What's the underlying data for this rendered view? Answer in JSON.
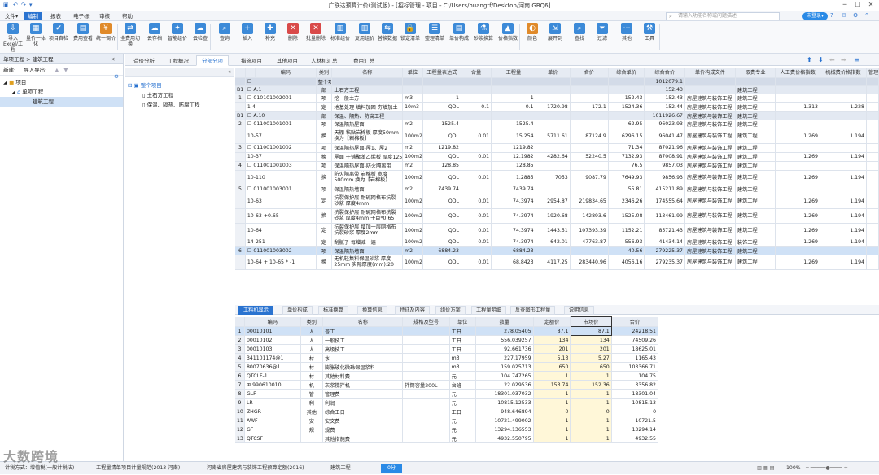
{
  "window": {
    "title": "广联达预算计价(测试版) - [招标管理 - 项目 - C:/Users/huangtf/Desktop/河南.GBQ6]",
    "quick_access": [
      "▣",
      "↶",
      "↷",
      "▾"
    ],
    "min": "─",
    "max": "☐",
    "close": "✕"
  },
  "menu": {
    "items": [
      "文件▾",
      "编制",
      "报表",
      "电子标",
      "审核",
      "帮助"
    ],
    "active": 1,
    "search_placeholder": "请输入功能名称或问题描述",
    "user_pill": "未登录▾"
  },
  "ribbon": {
    "buttons": [
      {
        "label": "导入Excel/工程",
        "color": "#3c8ad8",
        "glyph": "⇩"
      },
      {
        "label": "量价一体化",
        "color": "#3c8ad8",
        "glyph": "▦"
      },
      {
        "label": "项目自检",
        "color": "#3c8ad8",
        "glyph": "✔"
      },
      {
        "label": "费用查看",
        "color": "#3c8ad8",
        "glyph": "▤"
      },
      {
        "label": "统一调价",
        "color": "#e08a2a",
        "glyph": "¥"
      },
      {
        "label": "全费用切换",
        "color": "#3c8ad8",
        "glyph": "⇄"
      },
      {
        "label": "云存档",
        "color": "#3c8ad8",
        "glyph": "☁"
      },
      {
        "label": "智能组价",
        "color": "#3c8ad8",
        "glyph": "✦"
      },
      {
        "label": "云检查",
        "color": "#3c8ad8",
        "glyph": "☁"
      },
      {
        "label": "查询",
        "color": "#3c8ad8",
        "glyph": "⌕"
      },
      {
        "label": "插入",
        "color": "#3c8ad8",
        "glyph": "+"
      },
      {
        "label": "补充",
        "color": "#3c8ad8",
        "glyph": "✚"
      },
      {
        "label": "删除",
        "color": "#d94a4a",
        "glyph": "✕"
      },
      {
        "label": "批量删除",
        "color": "#d94a4a",
        "glyph": "✕"
      },
      {
        "label": "标准组价",
        "color": "#3c8ad8",
        "glyph": "▥"
      },
      {
        "label": "复用组价",
        "color": "#3c8ad8",
        "glyph": "▥"
      },
      {
        "label": "替换数据",
        "color": "#3c8ad8",
        "glyph": "⇆"
      },
      {
        "label": "锁定清单",
        "color": "#3c8ad8",
        "glyph": "🔒"
      },
      {
        "label": "整理清单",
        "color": "#3c8ad8",
        "glyph": "☰"
      },
      {
        "label": "单价构成",
        "color": "#3c8ad8",
        "glyph": "▤"
      },
      {
        "label": "砂浆换算",
        "color": "#3c8ad8",
        "glyph": "⚗"
      },
      {
        "label": "价格指数",
        "color": "#3c8ad8",
        "glyph": "▲"
      },
      {
        "label": "颜色",
        "color": "#e08a2a",
        "glyph": "◐"
      },
      {
        "label": "展开到",
        "color": "#3c8ad8",
        "glyph": "⇲"
      },
      {
        "label": "查找",
        "color": "#3c8ad8",
        "glyph": "⌕"
      },
      {
        "label": "过滤",
        "color": "#3c8ad8",
        "glyph": "⏷"
      },
      {
        "label": "其他",
        "color": "#3c8ad8",
        "glyph": "⋯"
      },
      {
        "label": "工具",
        "color": "#3c8ad8",
        "glyph": "⚒"
      }
    ]
  },
  "left": {
    "breadcrumb": "单项工程 > 建筑工程",
    "new_label": "新建·",
    "import_label": "导入导出·",
    "tree": [
      "项目",
      "单项工程",
      "建筑工程"
    ]
  },
  "tabs": {
    "items": [
      "造价分析",
      "工程概况",
      "分部分项",
      "措施项目",
      "其他项目",
      "人材机汇总",
      "费用汇总"
    ],
    "active": 2
  },
  "navtree": {
    "items": [
      "整个项目",
      "土石方工程",
      "保温、隔热、防腐工程"
    ]
  },
  "grid": {
    "headers": [
      "",
      "",
      "编码",
      "类别",
      "名称",
      "单位",
      "工程量表达式",
      "含量",
      "工程量",
      "单价",
      "合价",
      "综合单价",
      "综合合价",
      "单价构成文件",
      "取费专业",
      "人工费价格指数",
      "机械费价格指数",
      "管理"
    ],
    "rows": [
      {
        "cls": "g1",
        "cells": [
          "",
          "☐",
          "",
          "整个项目",
          "",
          "",
          "",
          "",
          "",
          "",
          "",
          "",
          "1012079.1",
          "",
          "",
          "",
          "",
          ""
        ]
      },
      {
        "cls": "g2",
        "cells": [
          "B1",
          "☐ A.1",
          "",
          "部",
          "土石方工程",
          "",
          "",
          "",
          "",
          "",
          "",
          "",
          "152.43",
          "",
          "建筑工程",
          "",
          "",
          ""
        ]
      },
      {
        "cls": "nor",
        "cells": [
          "1",
          "☐ 010101002001",
          "",
          "项",
          "挖一般土方",
          "m3",
          "1",
          "",
          "1",
          "",
          "",
          "152.43",
          "152.43",
          "房屋建筑与装饰工程",
          "建筑工程",
          "",
          "",
          ""
        ]
      },
      {
        "cls": "nor",
        "cells": [
          "",
          "1-4",
          "",
          "定",
          "地基处理 填料加固 夯填加土",
          "10m3",
          "QDL",
          "0.1",
          "0.1",
          "1720.98",
          "172.1",
          "1524.36",
          "152.44",
          "房屋建筑与装饰工程",
          "建筑工程",
          "1.313",
          "1.228",
          ""
        ]
      },
      {
        "cls": "g2",
        "cells": [
          "B1",
          "☐ A.10",
          "",
          "部",
          "保温、隔热、防腐工程",
          "",
          "",
          "",
          "",
          "",
          "",
          "",
          "1011926.67",
          "房屋建筑与装饰工程",
          "建筑工程",
          "",
          "",
          ""
        ]
      },
      {
        "cls": "nor",
        "cells": [
          "2",
          "☐ 011001001001",
          "",
          "项",
          "保温隔热屋面",
          "m2",
          "1525.4",
          "",
          "1525.4",
          "",
          "",
          "62.95",
          "96023.93",
          "房屋建筑与装饰工程",
          "建筑工程",
          "",
          "",
          ""
        ]
      },
      {
        "cls": "tall",
        "cells": [
          "",
          "10-57",
          "",
          "换",
          "天棚 粘贴岩棉板 厚度50mm 换为【岩棉板】",
          "100m2",
          "QDL",
          "0.01",
          "15.254",
          "5711.61",
          "87124.9",
          "6296.15",
          "96041.47",
          "房屋建筑与装饰工程",
          "建筑工程",
          "1.269",
          "1.194",
          ""
        ]
      },
      {
        "cls": "nor",
        "cells": [
          "3",
          "☐ 011001001002",
          "",
          "项",
          "保温隔热屋面-屋1、屋2",
          "m2",
          "1219.82",
          "",
          "1219.82",
          "",
          "",
          "71.34",
          "87021.96",
          "房屋建筑与装饰工程",
          "建筑工程",
          "",
          "",
          ""
        ]
      },
      {
        "cls": "nor",
        "cells": [
          "",
          "10-37",
          "",
          "换",
          "屋面 干铺聚苯乙烯板 厚度125mm",
          "100m2",
          "QDL",
          "0.01",
          "12.1982",
          "4282.64",
          "52240.5",
          "7132.93",
          "87008.91",
          "房屋建筑与装饰工程",
          "建筑工程",
          "1.269",
          "1.194",
          ""
        ]
      },
      {
        "cls": "nor",
        "cells": [
          "4",
          "☐ 011001001003",
          "",
          "项",
          "保温隔热屋面-防火隔离带",
          "m2",
          "128.85",
          "",
          "128.85",
          "",
          "",
          "76.5",
          "9857.03",
          "房屋建筑与装饰工程",
          "建筑工程",
          "",
          "",
          ""
        ]
      },
      {
        "cls": "tall",
        "cells": [
          "",
          "10-110",
          "",
          "换",
          "防火隔离带 岩棉板 宽度 500mm 换为【岩棉板】",
          "100m2",
          "QDL",
          "0.01",
          "1.2885",
          "7053",
          "9087.79",
          "7649.93",
          "9856.93",
          "房屋建筑与装饰工程",
          "建筑工程",
          "1.269",
          "1.194",
          ""
        ]
      },
      {
        "cls": "nor",
        "cells": [
          "5",
          "☐ 011001003001",
          "",
          "项",
          "保温隔热墙面",
          "m2",
          "7439.74",
          "",
          "7439.74",
          "",
          "",
          "55.81",
          "415211.89",
          "房屋建筑与装饰工程",
          "建筑工程",
          "",
          "",
          ""
        ]
      },
      {
        "cls": "tall",
        "cells": [
          "",
          "10-63",
          "",
          "定",
          "抗裂保护层 耐碱网格布抗裂砂浆 厚度4mm",
          "100m2",
          "QDL",
          "0.01",
          "74.3974",
          "2954.87",
          "219834.65",
          "2346.26",
          "174555.64",
          "房屋建筑与装饰工程",
          "建筑工程",
          "1.269",
          "1.194",
          ""
        ]
      },
      {
        "cls": "tall",
        "cells": [
          "",
          "10-63 +0.65",
          "",
          "换",
          "抗裂保护层 耐碱网格布抗裂砂浆 厚度4mm 子目*0.65",
          "100m2",
          "QDL",
          "0.01",
          "74.3974",
          "1920.68",
          "142893.6",
          "1525.08",
          "113461.99",
          "房屋建筑与装饰工程",
          "建筑工程",
          "1.269",
          "1.194",
          ""
        ]
      },
      {
        "cls": "tall",
        "cells": [
          "",
          "10-64",
          "",
          "定",
          "抗裂保护层 增加一层网格布抗裂砂浆 厚度2mm",
          "100m2",
          "QDL",
          "0.01",
          "74.3974",
          "1443.51",
          "107393.39",
          "1152.21",
          "85721.43",
          "房屋建筑与装饰工程",
          "建筑工程",
          "1.269",
          "1.194",
          ""
        ]
      },
      {
        "cls": "nor",
        "cells": [
          "",
          "14-251",
          "",
          "定",
          "刮腻子 每增减一遍",
          "100m2",
          "QDL",
          "0.01",
          "74.3974",
          "642.01",
          "47763.87",
          "556.93",
          "41434.14",
          "房屋建筑与装饰工程",
          "装饰工程",
          "1.269",
          "1.194",
          ""
        ]
      },
      {
        "cls": "sel",
        "cells": [
          "6",
          "☐ 011001003002",
          "",
          "项",
          "保温隔热墙面",
          "m2",
          "6884.23",
          "",
          "6884.23",
          "",
          "",
          "40.56",
          "279225.37",
          "房屋建筑与装饰工程",
          "建筑工程",
          "",
          "",
          ""
        ]
      },
      {
        "cls": "tall",
        "cells": [
          "",
          "10-64 + 10-65 * -1",
          "",
          "换",
          "无机轻集料保温砂浆 厚度25mm 实际厚度(mm):20",
          "100m2",
          "QDL",
          "0.01",
          "68.8423",
          "4117.25",
          "283440.96",
          "4056.16",
          "279235.37",
          "房屋建筑与装饰工程",
          "建筑工程",
          "1.269",
          "1.194",
          ""
        ]
      }
    ]
  },
  "lowtabs": {
    "items": [
      "工料机显示",
      "单价构成",
      "标准换算",
      "换算信息",
      "特征及内容",
      "组价方案",
      "工程量明细",
      "反查图形工程量",
      "说明信息"
    ],
    "active": 0
  },
  "lowgrid": {
    "headers": [
      "",
      "编码",
      "类别",
      "名称",
      "规格及型号",
      "单位",
      "数量",
      "定额价",
      "市场价",
      "合价"
    ],
    "rows": [
      [
        "1",
        "00010101",
        "人",
        "普工",
        "",
        "工日",
        "278.05405",
        "87.1",
        "87.1",
        "24218.51"
      ],
      [
        "2",
        "00010102",
        "人",
        "一般技工",
        "",
        "工日",
        "556.039257",
        "134",
        "134",
        "74509.26"
      ],
      [
        "3",
        "00010103",
        "人",
        "高级技工",
        "",
        "工日",
        "92.661736",
        "201",
        "201",
        "18625.01"
      ],
      [
        "4",
        "341101174@1",
        "材",
        "水",
        "",
        "m3",
        "227.17959",
        "5.13",
        "5.27",
        "1165.43"
      ],
      [
        "5",
        "80070636@1",
        "材",
        "膨胀玻化微珠保温浆料",
        "",
        "m3",
        "159.025713",
        "650",
        "650",
        "103366.71"
      ],
      [
        "6",
        "QTCLF-1",
        "材",
        "其他材料费",
        "",
        "元",
        "104.747265",
        "1",
        "1",
        "104.75"
      ],
      [
        "7",
        "⊞ 990610010",
        "机",
        "灰浆搅拌机",
        "拌筒容量200L",
        "台班",
        "22.029536",
        "153.74",
        "152.36",
        "3356.82"
      ],
      [
        "8",
        "GLF",
        "管",
        "管理费",
        "",
        "元",
        "18301.037032",
        "1",
        "1",
        "18301.04"
      ],
      [
        "9",
        "LR",
        "利",
        "利润",
        "",
        "元",
        "10815.12533",
        "1",
        "1",
        "10815.13"
      ],
      [
        "10",
        "ZHGR",
        "其他",
        "综合工日",
        "",
        "工日",
        "948.646894",
        "0",
        "0",
        "0"
      ],
      [
        "11",
        "AWF",
        "安",
        "安文费",
        "",
        "元",
        "10721.499002",
        "1",
        "1",
        "10721.5"
      ],
      [
        "12",
        "GF",
        "规",
        "规费",
        "",
        "元",
        "13294.136553",
        "1",
        "1",
        "13294.14"
      ],
      [
        "13",
        "QTCSF",
        "",
        "其他措施费",
        "",
        "元",
        "4932.550795",
        "1",
        "1",
        "4932.55"
      ]
    ]
  },
  "status": {
    "items": [
      "计税方式：增值税(一般计税法)",
      "工程量清单项目计量规范(2013-河南)",
      "河南省房屋建筑与装饰工程预算定额(2016)",
      "建筑工程"
    ],
    "button": "0分",
    "zoom": "100%",
    "watermark": "大数跨境"
  }
}
